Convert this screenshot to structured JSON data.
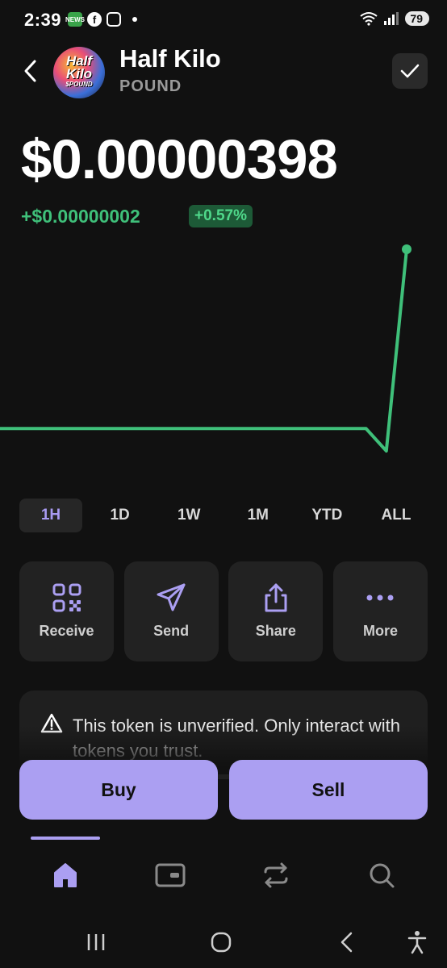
{
  "status_bar": {
    "time": "2:39",
    "news_icon_text": "NEWS",
    "battery": "79"
  },
  "header": {
    "token_name": "Half Kilo",
    "token_symbol": "POUND",
    "avatar_text_line1": "Half",
    "avatar_text_line2": "Kilo",
    "avatar_text_line3": "$POUND"
  },
  "price": {
    "value": "$0.00000398",
    "change": "+$0.00000002",
    "change_percent": "+0.57%"
  },
  "chart_data": {
    "type": "line",
    "title": "",
    "xlabel": "",
    "ylabel": "",
    "grid": false,
    "color": "#3fc07a",
    "series": [
      {
        "values": [
          3.9e-06,
          3.9e-06,
          3.9e-06,
          3.9e-06,
          3.9e-06,
          3.9e-06,
          3.9e-06,
          3.9e-06,
          3.9e-06,
          3.9e-06,
          3.9e-06,
          3.9e-06,
          3.9e-06,
          3.9e-06,
          3.9e-06,
          3.9e-06,
          3.9e-06,
          3.9e-06,
          3.9e-06,
          3.89e-06,
          3.98e-06
        ]
      }
    ]
  },
  "ranges": {
    "items": [
      "1H",
      "1D",
      "1W",
      "1M",
      "YTD",
      "ALL"
    ],
    "active": "1H"
  },
  "actions": {
    "receive": "Receive",
    "send": "Send",
    "share": "Share",
    "more": "More"
  },
  "warning": {
    "text": "This token is unverified. Only interact with tokens you trust."
  },
  "trade": {
    "buy": "Buy",
    "sell": "Sell"
  },
  "colors": {
    "background": "#111111",
    "accent": "#ab9ff2",
    "positive": "#3fc07a",
    "card": "#222222"
  }
}
